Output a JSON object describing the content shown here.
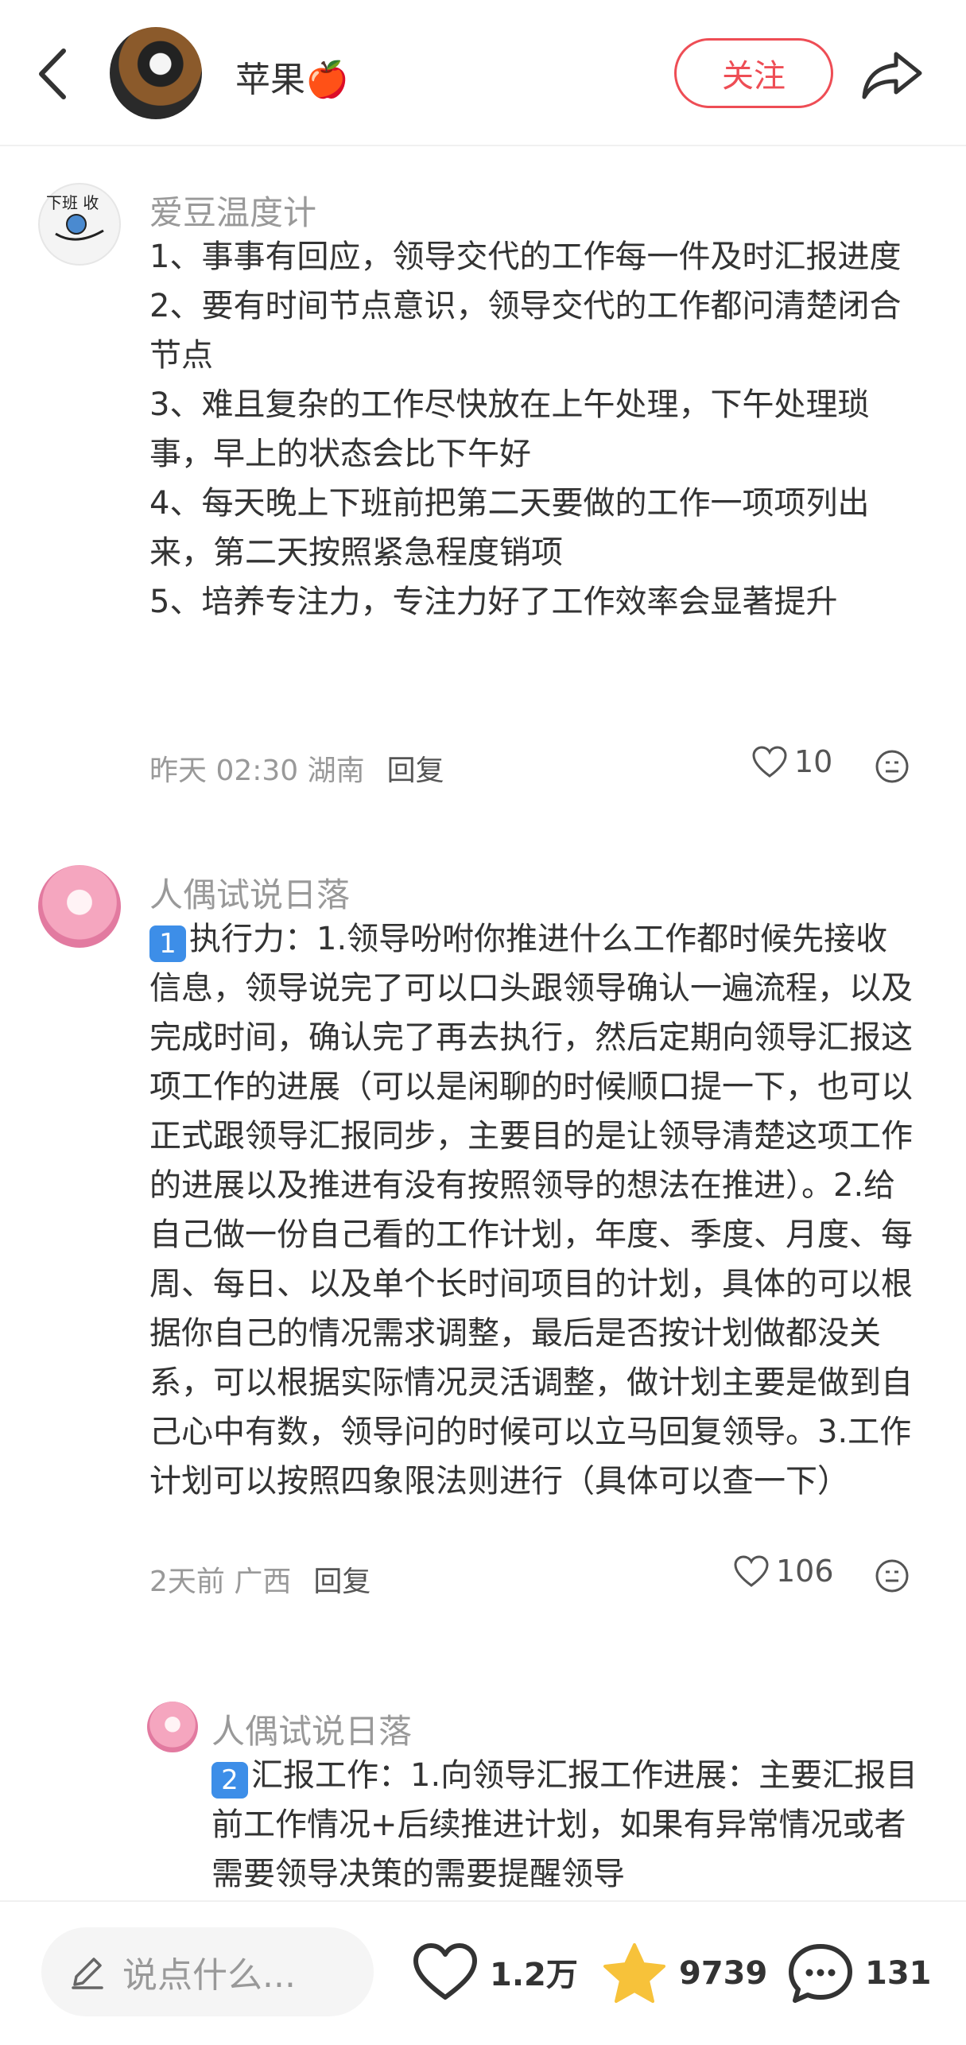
{
  "header": {
    "author_name": "苹果🍎",
    "follow_label": "关注"
  },
  "comments": [
    {
      "nickname": "爱豆温度计",
      "avatar_text": "下班 收",
      "text": "1、事事有回应，领导交代的工作每一件及时汇报进度\n2、要有时间节点意识，领导交代的工作都问清楚闭合节点\n3、难且复杂的工作尽快放在上午处理，下午处理琐事，早上的状态会比下午好\n4、每天晚上下班前把第二天要做的工作一项项列出来，第二天按照紧急程度销项\n5、培养专注力，专注力好了工作效率会显著提升",
      "time_location": "昨天 02:30 湖南",
      "reply_label": "回复",
      "likes": "10"
    },
    {
      "nickname": "人偶试说日落",
      "badge": "1",
      "text": "执行力：1.领导吩咐你推进什么工作都时候先接收信息，领导说完了可以口头跟领导确认一遍流程，以及完成时间，确认完了再去执行，然后定期向领导汇报这项工作的进展（可以是闲聊的时候顺口提一下，也可以正式跟领导汇报同步，主要目的是让领导清楚这项工作的进展以及推进有没有按照领导的想法在推进）。2.给自己做一份自己看的工作计划，年度、季度、月度、每周、每日、以及单个长时间项目的计划，具体的可以根据你自己的情况需求调整，最后是否按计划做都没关系，可以根据实际情况灵活调整，做计划主要是做到自己心中有数，领导问的时候可以立马回复领导。3.工作计划可以按照四象限法则进行（具体可以查一下）",
      "time_location": "2天前 广西",
      "reply_label": "回复",
      "likes": "106"
    },
    {
      "nickname": "人偶试说日落",
      "badge": "2",
      "text": "汇报工作：1.向领导汇报工作进展：主要汇报目前工作情况+后续推进计划，如果有异常情况或者需要领导决策的需要提醒领导"
    }
  ],
  "bottom_bar": {
    "input_placeholder": "说点什么...",
    "likes": "1.2万",
    "stars": "9739",
    "comments": "131"
  }
}
